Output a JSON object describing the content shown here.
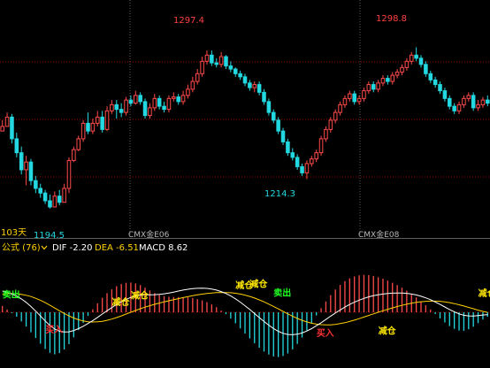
{
  "colors": {
    "background": "#000000",
    "up": "#ff4a4a",
    "down": "#23d8e0",
    "grid_red": "#9a0000",
    "grid_gray": "#5c5c5c",
    "price_high": "#ff4040",
    "price_low": "#23d8e0",
    "indicator_name": "#ffd000",
    "dif_line": "#ffffff",
    "dea_line": "#ffd000",
    "signal_green": "#22ff22",
    "signal_yellow": "#ffe800",
    "signal_red": "#ff3030",
    "contract_label": "#b8b8b8",
    "period_label": "#ffd000"
  },
  "period_label": "103天",
  "annotations": {
    "high_1": "1297.4",
    "high_2": "1298.8",
    "low_1": "1194.5",
    "low_2": "1214.3"
  },
  "contract_labels": [
    "CMX金E06",
    "CMX金E08"
  ],
  "indicator_bar": {
    "name": "公式 (76)",
    "dropdown_icon": "chevron-down-icon",
    "dif_label": "DIF -2.20",
    "dea_label": "DEA -6.51",
    "macd_label": "MACD 8.62"
  },
  "signal_labels": {
    "sell": "卖出",
    "reduce": "减仓",
    "buy": "买入"
  },
  "chart_data": [
    {
      "type": "candlestick",
      "title": "",
      "x_count": 103,
      "ylim": [
        1180,
        1325
      ],
      "grid": true,
      "closes": [
        1248,
        1254,
        1240,
        1231,
        1220,
        1225,
        1213,
        1208,
        1205,
        1200,
        1196,
        1203,
        1199,
        1208,
        1226,
        1233,
        1240,
        1250,
        1245,
        1250,
        1254,
        1246,
        1258,
        1262,
        1259,
        1257,
        1265,
        1263,
        1268,
        1264,
        1255,
        1260,
        1266,
        1261,
        1259,
        1266,
        1267,
        1264,
        1268,
        1272,
        1277,
        1282,
        1290,
        1294,
        1289,
        1288,
        1293,
        1287,
        1285,
        1282,
        1280,
        1276,
        1273,
        1275,
        1270,
        1264,
        1257,
        1252,
        1245,
        1238,
        1231,
        1228,
        1222,
        1218,
        1224,
        1227,
        1231,
        1240,
        1246,
        1252,
        1257,
        1262,
        1266,
        1269,
        1264,
        1266,
        1271,
        1275,
        1272,
        1276,
        1279,
        1277,
        1281,
        1283,
        1286,
        1290,
        1294,
        1292,
        1288,
        1282,
        1278,
        1275,
        1271,
        1266,
        1261,
        1258,
        1262,
        1266,
        1268,
        1260,
        1262,
        1265,
        1263
      ],
      "highs": [
        1252,
        1257,
        1256,
        1244,
        1235,
        1229,
        1227,
        1216,
        1211,
        1207,
        1204,
        1206,
        1207,
        1211,
        1228,
        1235,
        1242,
        1252,
        1257,
        1253,
        1258,
        1258,
        1261,
        1265,
        1265,
        1263,
        1267,
        1268,
        1271,
        1270,
        1266,
        1263,
        1269,
        1268,
        1264,
        1268,
        1270,
        1269,
        1271,
        1275,
        1280,
        1285,
        1293,
        1297,
        1297,
        1292,
        1296,
        1294,
        1290,
        1286,
        1284,
        1282,
        1278,
        1277,
        1277,
        1272,
        1266,
        1259,
        1254,
        1247,
        1240,
        1234,
        1230,
        1224,
        1226,
        1229,
        1233,
        1242,
        1248,
        1254,
        1259,
        1264,
        1268,
        1271,
        1271,
        1268,
        1273,
        1277,
        1277,
        1278,
        1281,
        1281,
        1283,
        1285,
        1288,
        1292,
        1296,
        1299,
        1294,
        1290,
        1284,
        1280,
        1277,
        1273,
        1268,
        1263,
        1264,
        1268,
        1270,
        1270,
        1265,
        1267,
        1268
      ],
      "lows": [
        1245,
        1249,
        1237,
        1228,
        1217,
        1210,
        1210,
        1205,
        1202,
        1198,
        1195,
        1196,
        1197,
        1199,
        1205,
        1225,
        1232,
        1238,
        1243,
        1243,
        1248,
        1244,
        1245,
        1256,
        1253,
        1254,
        1255,
        1261,
        1262,
        1262,
        1253,
        1253,
        1258,
        1259,
        1257,
        1257,
        1264,
        1262,
        1262,
        1266,
        1270,
        1275,
        1280,
        1288,
        1287,
        1286,
        1286,
        1285,
        1283,
        1280,
        1278,
        1274,
        1271,
        1270,
        1268,
        1262,
        1255,
        1250,
        1243,
        1236,
        1229,
        1226,
        1220,
        1216,
        1214,
        1222,
        1225,
        1229,
        1238,
        1244,
        1250,
        1255,
        1260,
        1264,
        1262,
        1262,
        1264,
        1269,
        1270,
        1270,
        1274,
        1275,
        1275,
        1279,
        1281,
        1284,
        1288,
        1290,
        1286,
        1280,
        1276,
        1273,
        1269,
        1264,
        1259,
        1256,
        1256,
        1260,
        1264,
        1258,
        1258,
        1260,
        1261
      ]
    },
    {
      "type": "macd",
      "series": [
        {
          "name": "DIF",
          "values": [
            20.0,
            18.8,
            17.2,
            15.3,
            12.6,
            9.3,
            5.4,
            1.1,
            -3.5,
            -8.2,
            -12.5,
            -15.8,
            -17.8,
            -18.6,
            -18.4,
            -17.2,
            -15.4,
            -13.2,
            -10.6,
            -7.8,
            -4.8,
            -1.7,
            1.4,
            4.4,
            7.3,
            9.9,
            12.2,
            14.0,
            15.3,
            16.1,
            16.4,
            16.5,
            16.6,
            16.9,
            17.4,
            18.1,
            19.0,
            20.0,
            20.9,
            21.7,
            22.3,
            22.6,
            22.7,
            22.5,
            21.9,
            20.9,
            19.5,
            17.7,
            15.4,
            12.7,
            9.6,
            6.2,
            2.6,
            -1.2,
            -5.0,
            -8.7,
            -12.2,
            -15.3,
            -17.9,
            -19.8,
            -20.9,
            -21.2,
            -20.7,
            -19.5,
            -17.7,
            -15.4,
            -12.7,
            -9.8,
            -6.8,
            -3.7,
            -0.7,
            2.2,
            4.9,
            7.3,
            9.5,
            11.4,
            13.1,
            14.5,
            15.6,
            16.5,
            17.2,
            17.7,
            18.0,
            18.2,
            18.1,
            17.8,
            17.2,
            16.3,
            15.1,
            13.6,
            11.8,
            9.7,
            7.4,
            5.0,
            2.6,
            0.4,
            -1.5,
            -2.8,
            -3.4,
            -3.5,
            -3.1,
            -2.6,
            -2.2
          ]
        },
        {
          "name": "DEA",
          "values": [
            17.0,
            17.5,
            17.6,
            17.4,
            16.9,
            16.0,
            14.8,
            13.2,
            11.3,
            9.1,
            6.6,
            4.0,
            1.4,
            -1.1,
            -3.4,
            -5.4,
            -7.0,
            -8.2,
            -8.9,
            -9.2,
            -9.0,
            -8.5,
            -7.6,
            -6.4,
            -5.0,
            -3.4,
            -1.7,
            0.0,
            1.7,
            3.3,
            4.8,
            6.2,
            7.5,
            8.7,
            9.8,
            10.8,
            11.8,
            12.8,
            13.8,
            14.7,
            15.6,
            16.4,
            17.1,
            17.7,
            18.2,
            18.5,
            18.7,
            18.6,
            18.4,
            17.9,
            17.2,
            16.2,
            14.9,
            13.4,
            11.7,
            9.8,
            7.7,
            5.5,
            3.2,
            0.8,
            -1.5,
            -3.7,
            -5.8,
            -7.6,
            -9.1,
            -10.3,
            -11.2,
            -11.7,
            -11.9,
            -11.8,
            -11.4,
            -10.7,
            -9.8,
            -8.7,
            -7.4,
            -6.0,
            -4.5,
            -3.0,
            -1.5,
            0.0,
            1.4,
            2.8,
            4.1,
            5.4,
            6.5,
            7.6,
            8.5,
            9.3,
            9.9,
            10.3,
            10.5,
            10.5,
            10.3,
            9.8,
            9.1,
            8.2,
            7.1,
            5.9,
            4.6,
            3.3,
            2.0,
            0.8,
            -0.1
          ]
        },
        {
          "name": "MACD",
          "values": [
            6.0,
            2.6,
            -0.8,
            -4.2,
            -8.6,
            -13.4,
            -18.8,
            -24.2,
            -29.6,
            -34.6,
            -38.2,
            -39.6,
            -38.4,
            -35.0,
            -30.0,
            -23.6,
            -16.8,
            -10.0,
            -3.4,
            2.8,
            8.4,
            13.6,
            18.0,
            21.6,
            24.6,
            26.6,
            27.8,
            28.0,
            27.2,
            25.6,
            23.2,
            20.6,
            18.2,
            16.4,
            15.2,
            14.6,
            14.4,
            14.4,
            14.2,
            14.0,
            13.4,
            12.4,
            11.2,
            9.6,
            7.4,
            4.8,
            1.6,
            -1.8,
            -6.0,
            -10.4,
            -15.2,
            -20.0,
            -24.6,
            -29.2,
            -33.4,
            -37.0,
            -39.8,
            -41.6,
            -42.2,
            -41.2,
            -38.8,
            -35.0,
            -29.8,
            -23.8,
            -17.2,
            -10.2,
            -3.0,
            3.8,
            10.2,
            16.2,
            21.4,
            25.8,
            29.4,
            32.0,
            33.8,
            34.8,
            35.2,
            35.0,
            34.2,
            33.0,
            31.6,
            29.8,
            27.8,
            25.6,
            23.2,
            20.4,
            17.4,
            14.0,
            10.4,
            6.6,
            2.6,
            -1.6,
            -5.8,
            -9.6,
            -13.0,
            -15.6,
            -17.2,
            -17.4,
            -16.0,
            -13.6,
            -10.2,
            -6.8,
            -4.2
          ]
        }
      ],
      "signals": [
        {
          "kind": "sell",
          "index": 2,
          "value": 17.2
        },
        {
          "kind": "buy",
          "index": 11,
          "value": -15.8
        },
        {
          "kind": "reduce",
          "index": 25,
          "value": 9.9
        },
        {
          "kind": "reduce",
          "index": 29,
          "value": 16.1
        },
        {
          "kind": "reduce",
          "index": 51,
          "value": 26
        },
        {
          "kind": "reduce",
          "index": 54,
          "value": 27
        },
        {
          "kind": "sell",
          "index": 59,
          "value": 18.8
        },
        {
          "kind": "buy",
          "index": 68,
          "value": -19.0
        },
        {
          "kind": "reduce",
          "index": 81,
          "value": -17.0
        },
        {
          "kind": "reduce",
          "index": 102,
          "value": 18.2
        },
        {
          "kind": "sell",
          "index": 108,
          "value": 12.6
        },
        {
          "kind": "buy",
          "index": 125,
          "value": -21.0
        }
      ]
    }
  ]
}
